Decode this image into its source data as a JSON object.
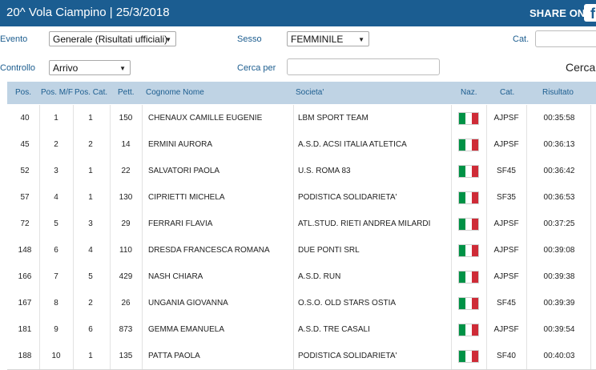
{
  "header": {
    "title": "20^ Vola Ciampino  |  25/3/2018",
    "share_label": "SHARE ON",
    "facebook_glyph": "f"
  },
  "filters": {
    "evento_label": "Evento",
    "evento_value": "Generale (Risultati ufficiali)",
    "sesso_label": "Sesso",
    "sesso_value": "FEMMINILE",
    "cat_label": "Cat.",
    "controllo_label": "Controllo",
    "controllo_value": "Arrivo",
    "cerca_per_label": "Cerca per",
    "cerca_button": "Cerca"
  },
  "table": {
    "columns": [
      "Pos.",
      "Pos. M/F",
      "Pos. Cat.",
      "Pett.",
      "Cognome Nome",
      "Societa'",
      "Naz.",
      "Cat.",
      "Risultato"
    ],
    "flag_colors": [
      "#009246",
      "#ffffff",
      "#ce2b37"
    ],
    "rows": [
      {
        "pos": "40",
        "pos_mf": "1",
        "pos_cat": "1",
        "pett": "150",
        "nome": "CHENAUX CAMILLE EUGENIE",
        "societa": "LBM SPORT TEAM",
        "cat": "AJPSF",
        "risultato": "00:35:58"
      },
      {
        "pos": "45",
        "pos_mf": "2",
        "pos_cat": "2",
        "pett": "14",
        "nome": "ERMINI AURORA",
        "societa": "A.S.D. ACSI ITALIA ATLETICA",
        "cat": "AJPSF",
        "risultato": "00:36:13"
      },
      {
        "pos": "52",
        "pos_mf": "3",
        "pos_cat": "1",
        "pett": "22",
        "nome": "SALVATORI PAOLA",
        "societa": "U.S. ROMA 83",
        "cat": "SF45",
        "risultato": "00:36:42"
      },
      {
        "pos": "57",
        "pos_mf": "4",
        "pos_cat": "1",
        "pett": "130",
        "nome": "CIPRIETTI MICHELA",
        "societa": "PODISTICA SOLIDARIETA'",
        "cat": "SF35",
        "risultato": "00:36:53"
      },
      {
        "pos": "72",
        "pos_mf": "5",
        "pos_cat": "3",
        "pett": "29",
        "nome": "FERRARI FLAVIA",
        "societa": "ATL.STUD. RIETI ANDREA MILARDI",
        "cat": "AJPSF",
        "risultato": "00:37:25"
      },
      {
        "pos": "148",
        "pos_mf": "6",
        "pos_cat": "4",
        "pett": "110",
        "nome": "DRESDA FRANCESCA ROMANA",
        "societa": "DUE PONTI SRL",
        "cat": "AJPSF",
        "risultato": "00:39:08"
      },
      {
        "pos": "166",
        "pos_mf": "7",
        "pos_cat": "5",
        "pett": "429",
        "nome": "NASH CHIARA",
        "societa": "A.S.D. RUN",
        "cat": "AJPSF",
        "risultato": "00:39:38"
      },
      {
        "pos": "167",
        "pos_mf": "8",
        "pos_cat": "2",
        "pett": "26",
        "nome": "UNGANIA GIOVANNA",
        "societa": "O.S.O. OLD STARS OSTIA",
        "cat": "SF45",
        "risultato": "00:39:39"
      },
      {
        "pos": "181",
        "pos_mf": "9",
        "pos_cat": "6",
        "pett": "873",
        "nome": "GEMMA EMANUELA",
        "societa": "A.S.D. TRE CASALI",
        "cat": "AJPSF",
        "risultato": "00:39:54"
      },
      {
        "pos": "188",
        "pos_mf": "10",
        "pos_cat": "1",
        "pett": "135",
        "nome": "PATTA PAOLA",
        "societa": "PODISTICA SOLIDARIETA'",
        "cat": "SF40",
        "risultato": "00:40:03"
      }
    ]
  }
}
